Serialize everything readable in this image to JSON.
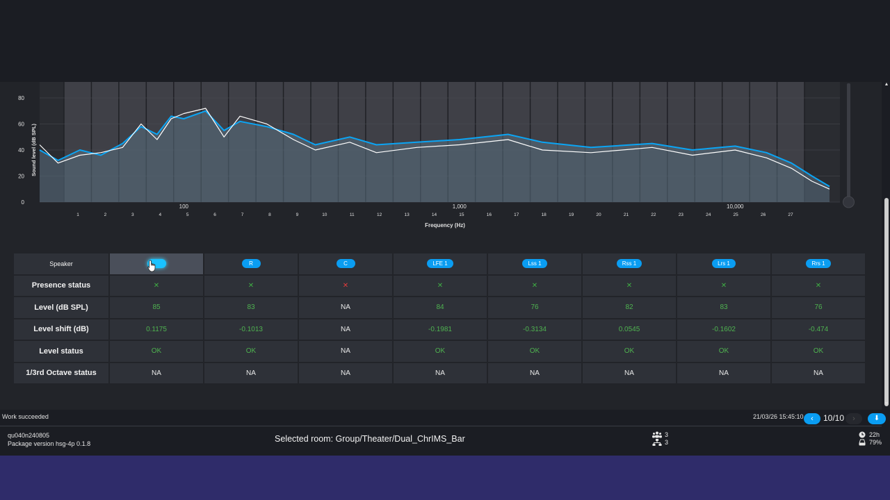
{
  "chart_data": {
    "type": "line",
    "title": "",
    "xlabel": "Frequency (Hz)",
    "ylabel": "Sound level (dB SPL)",
    "x_scale": "log",
    "xlim": [
      30,
      24000
    ],
    "ylim": [
      0,
      80
    ],
    "y_ticks": [
      "0",
      "20",
      "40",
      "60",
      "80"
    ],
    "x_tick_labels": [
      "100",
      "1,000",
      "10,000"
    ],
    "x_tick_values": [
      100,
      1000,
      10000
    ],
    "band_numbers": [
      "1",
      "2",
      "3",
      "4",
      "5",
      "6",
      "7",
      "8",
      "9",
      "10",
      "11",
      "12",
      "13",
      "14",
      "15",
      "16",
      "17",
      "18",
      "19",
      "20",
      "21",
      "22",
      "23",
      "24",
      "25",
      "26",
      "27"
    ],
    "grid": true,
    "series": [
      {
        "color": "#0aa5f5",
        "x": [
          30,
          35,
          42,
          50,
          60,
          70,
          80,
          90,
          100,
          120,
          140,
          160,
          200,
          250,
          300,
          400,
          500,
          700,
          1000,
          1500,
          2000,
          3000,
          5000,
          7000,
          10000,
          13000,
          16000,
          19000,
          22000
        ],
        "values": [
          40,
          32,
          40,
          36,
          45,
          58,
          52,
          66,
          64,
          70,
          55,
          62,
          58,
          52,
          44,
          50,
          44,
          46,
          48,
          52,
          46,
          42,
          45,
          40,
          43,
          38,
          30,
          20,
          12
        ]
      },
      {
        "color": "#ffffff",
        "x": [
          30,
          35,
          42,
          50,
          60,
          70,
          80,
          90,
          100,
          120,
          140,
          160,
          200,
          250,
          300,
          400,
          500,
          700,
          1000,
          1500,
          2000,
          3000,
          5000,
          7000,
          10000,
          13000,
          16000,
          19000,
          22000
        ],
        "values": [
          44,
          30,
          36,
          38,
          42,
          60,
          48,
          64,
          68,
          72,
          50,
          66,
          60,
          48,
          40,
          46,
          38,
          42,
          44,
          48,
          40,
          38,
          42,
          36,
          40,
          34,
          26,
          16,
          10
        ]
      }
    ]
  },
  "table": {
    "row_labels": [
      "Speaker",
      "Presence status",
      "Level (dB SPL)",
      "Level shift (dB)",
      "Level status",
      "1/3rd Octave status"
    ],
    "speakers": [
      {
        "label": "",
        "presence": "✕",
        "presence_ok": true,
        "level": "85",
        "shift": "0.1175",
        "level_status": "OK",
        "octave_status": "NA"
      },
      {
        "label": "R",
        "presence": "✕",
        "presence_ok": true,
        "level": "83",
        "shift": "-0.1013",
        "level_status": "OK",
        "octave_status": "NA"
      },
      {
        "label": "C",
        "presence": "✕",
        "presence_ok": false,
        "level": "NA",
        "shift": "NA",
        "level_status": "NA",
        "octave_status": "NA"
      },
      {
        "label": "LFE 1",
        "presence": "✕",
        "presence_ok": true,
        "level": "84",
        "shift": "-0.1981",
        "level_status": "OK",
        "octave_status": "NA"
      },
      {
        "label": "Lss 1",
        "presence": "✕",
        "presence_ok": true,
        "level": "76",
        "shift": "-0.3134",
        "level_status": "OK",
        "octave_status": "NA"
      },
      {
        "label": "Rss 1",
        "presence": "✕",
        "presence_ok": true,
        "level": "82",
        "shift": "0.0545",
        "level_status": "OK",
        "octave_status": "NA"
      },
      {
        "label": "Lrs 1",
        "presence": "✕",
        "presence_ok": true,
        "level": "83",
        "shift": "-0.1602",
        "level_status": "OK",
        "octave_status": "NA"
      },
      {
        "label": "Rrs 1",
        "presence": "✕",
        "presence_ok": true,
        "level": "76",
        "shift": "-0.474",
        "level_status": "OK",
        "octave_status": "NA"
      }
    ]
  },
  "status_bar": {
    "work_status": "Work succeeded",
    "timestamp": "21/03/26 15:45:10",
    "page_indicator": "10/10",
    "prev_icon": "‹",
    "next_icon": "›",
    "download_icon": "⬇"
  },
  "footer": {
    "device_id": "qu040n240805",
    "package_version": "Package version hsg-4p 0.1.8",
    "selected_room": "Selected room: Group/Theater/Dual_ChrIMS_Bar",
    "users_count": "3",
    "network_count": "3",
    "time_value": "22h",
    "storage_value": "79%"
  },
  "colors": {
    "accent": "#0a9df2",
    "ok": "#3fae44",
    "fail": "#e33b3b",
    "background": "#222429",
    "bottom_band": "#2f2c6a"
  }
}
